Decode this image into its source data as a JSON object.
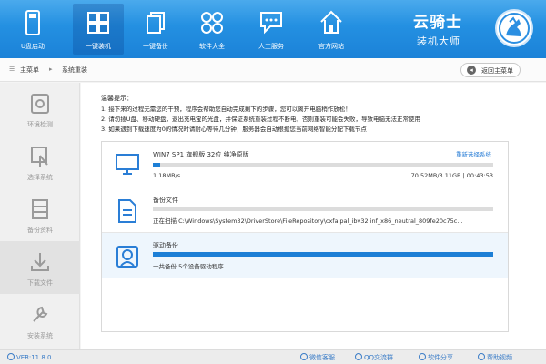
{
  "nav": {
    "items": [
      {
        "label": "U盘启动",
        "icon": "usb-drive-icon"
      },
      {
        "label": "一键装机",
        "icon": "install-grid-icon"
      },
      {
        "label": "一键备份",
        "icon": "backup-copy-icon"
      },
      {
        "label": "软件大全",
        "icon": "software-apps-icon"
      },
      {
        "label": "人工服务",
        "icon": "chat-service-icon"
      },
      {
        "label": "官方网站",
        "icon": "home-website-icon"
      }
    ],
    "active": "一键装机"
  },
  "brand": {
    "line1": "云骑士",
    "line2": "装机大师"
  },
  "breadcrumb": {
    "home": "主菜单",
    "separator": "▸",
    "current": "系统重装"
  },
  "back_button": {
    "label": "返回主菜单"
  },
  "sidebar": {
    "items": [
      {
        "label": "环境检测",
        "icon": "environment-check-icon"
      },
      {
        "label": "选择系统",
        "icon": "select-system-icon"
      },
      {
        "label": "备份资料",
        "icon": "backup-data-icon"
      },
      {
        "label": "下载文件",
        "icon": "download-file-icon"
      },
      {
        "label": "安装系统",
        "icon": "install-system-icon"
      }
    ],
    "active": "下载文件"
  },
  "tips": {
    "title": "温馨提示：",
    "lines": [
      "1. 接下来的过程无需您的干预，程序会帮助您自动完成剩下的步骤，您可以离开电脑稍作放松！",
      "2. 请勿插U盘、移动硬盘，退出充电宝的光盘，并保证系统重装过程不断电，否则重装可能会失败，导致电脑无法正常使用",
      "3. 如果遇到下载速度为0的情况时请耐心等待几分钟，服务器会自动根据您当前网络智能分配下载节点"
    ]
  },
  "tasks": [
    {
      "title": "WIN7 SP1 旗舰版 32位 纯净原版",
      "link": "重新选择系统",
      "speed": "1.18MB/s",
      "size": "70.52MB/3.11GB | 00:43:53",
      "progress": 0.022,
      "icon": "monitor-icon"
    },
    {
      "title": "备份文件",
      "detail": "正在扫描 C:\\Windows\\System32\\DriverStore\\FileRepository\\cxfalpal_ibv32.inf_x86_neutral_809fe20c75c...",
      "progress": 0,
      "icon": "document-icon"
    },
    {
      "title": "驱动备份",
      "detail": "一共备份 5个设备驱动程序",
      "progress": 1.0,
      "icon": "driver-backup-icon"
    }
  ],
  "footer": {
    "version": "VER:11.8.0",
    "links": [
      "微信客服",
      "QQ交流群",
      "软件分享",
      "帮助视频"
    ]
  },
  "colors": {
    "accent": "#1d7fd6",
    "topbar": "#2590e2"
  }
}
